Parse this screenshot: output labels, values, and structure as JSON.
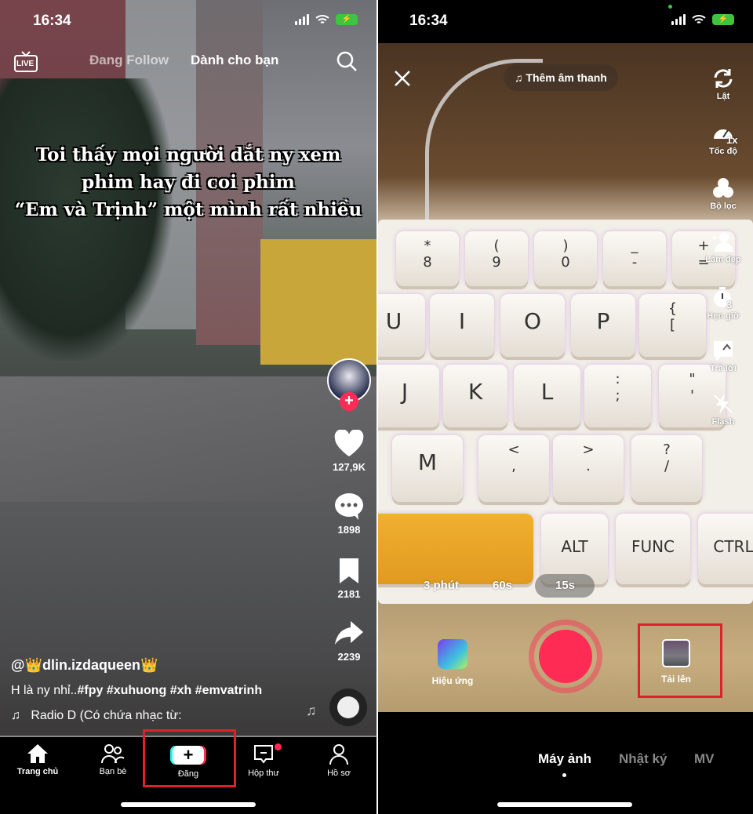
{
  "left": {
    "status": {
      "time": "16:34"
    },
    "top_tabs": {
      "live_label": "LIVE",
      "following": "Đang Follow",
      "for_you": "Dành cho bạn"
    },
    "caption_lines": [
      "Toi thấy mọi người dắt ny xem",
      "phim hay đi coi phim",
      "“Em và Trịnh” một mình rất nhiều"
    ],
    "rail": {
      "likes": "127,9K",
      "comments": "1898",
      "saves": "2181",
      "shares": "2239"
    },
    "post": {
      "username": "@👑dlin.izdaqueen👑",
      "description_plain": "H là ny nhỉ..",
      "hashtags": "#fpy #xuhuong #xh #emvatrinh",
      "music": "Radio D (Có chứa nhạc từ:"
    },
    "nav": [
      {
        "label": "Trang chủ",
        "icon": "home-icon"
      },
      {
        "label": "Bạn bè",
        "icon": "friends-icon"
      },
      {
        "label": "Đăng",
        "icon": "create-plus-icon"
      },
      {
        "label": "Hộp thư",
        "icon": "inbox-icon"
      },
      {
        "label": "Hồ sơ",
        "icon": "profile-icon"
      }
    ],
    "highlight_color": "#e0202a"
  },
  "right": {
    "status": {
      "time": "16:34"
    },
    "add_sound": "Thêm âm thanh",
    "tools": [
      {
        "label": "Lật",
        "icon": "flip-camera-icon"
      },
      {
        "label": "Tốc độ",
        "icon": "speed-icon",
        "badge": "1x"
      },
      {
        "label": "Bộ lọc",
        "icon": "filters-icon"
      },
      {
        "label": "Làm đẹp",
        "icon": "beauty-icon"
      },
      {
        "label": "Hẹn giờ",
        "icon": "timer-icon",
        "badge": "3"
      },
      {
        "label": "Trả lời",
        "icon": "reply-icon"
      },
      {
        "label": "Flash",
        "icon": "flash-off-icon"
      }
    ],
    "durations": [
      "3 phút",
      "60s",
      "15s"
    ],
    "selected_duration": "15s",
    "effects_label": "Hiệu ứng",
    "upload_label": "Tải lên",
    "modes": [
      "Máy ảnh",
      "Nhật ký",
      "MV"
    ],
    "selected_mode": "Máy ảnh",
    "record_color": "#fe2c55",
    "keyboard": {
      "keys": [
        {
          "top": "*",
          "bottom": "8"
        },
        {
          "top": "(",
          "bottom": "9"
        },
        {
          "top": ")",
          "bottom": "0"
        },
        {
          "top": "_",
          "bottom": "-"
        },
        {
          "top": "+",
          "bottom": "="
        },
        {
          "top": "U",
          "bottom": ""
        },
        {
          "top": "I",
          "bottom": ""
        },
        {
          "top": "O",
          "bottom": ""
        },
        {
          "top": "P",
          "bottom": ""
        },
        {
          "top": "{",
          "bottom": "["
        },
        {
          "top": "J",
          "bottom": ""
        },
        {
          "top": "K",
          "bottom": ""
        },
        {
          "top": "L",
          "bottom": ""
        },
        {
          "top": ":",
          "bottom": ";"
        },
        {
          "top": "\"",
          "bottom": "'"
        },
        {
          "top": "M",
          "bottom": ""
        },
        {
          "top": "<",
          "bottom": ","
        },
        {
          "top": ">",
          "bottom": "."
        },
        {
          "top": "?",
          "bottom": "/"
        },
        {
          "top": "",
          "bottom": ""
        },
        {
          "top": "ALT",
          "bottom": ""
        },
        {
          "top": "FUNC",
          "bottom": ""
        },
        {
          "top": "CTRL",
          "bottom": ""
        }
      ]
    }
  }
}
